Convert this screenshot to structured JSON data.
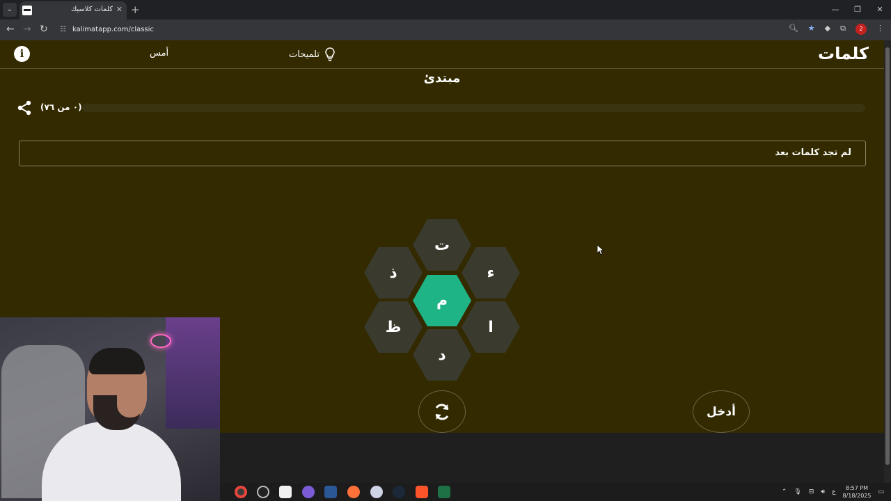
{
  "browser": {
    "tab_title": "كلمات كلاسيك",
    "url": "kalimatapp.com/classic",
    "profile_badge": "2"
  },
  "app": {
    "logo": "كلمات",
    "hints_label": "تلميحات",
    "yesterday_label": "أمس",
    "level": "مبتدئ",
    "progress_text": "(٠ من ٧٦)",
    "progress_found": 0,
    "progress_total": 76,
    "found_words_placeholder": "لم تجد كلمات بعد",
    "letters": {
      "center": "م",
      "top": "ت",
      "upper_right": "ء",
      "lower_right": "ا",
      "bottom": "د",
      "lower_left": "ظ",
      "upper_left": "ذ"
    },
    "enter_label": "أدخل",
    "accent_color": "#1fb486",
    "background_color": "#332a00"
  },
  "taskbar": {
    "time": "8:57 PM",
    "date": "8/18/2025",
    "lang": "ع"
  }
}
